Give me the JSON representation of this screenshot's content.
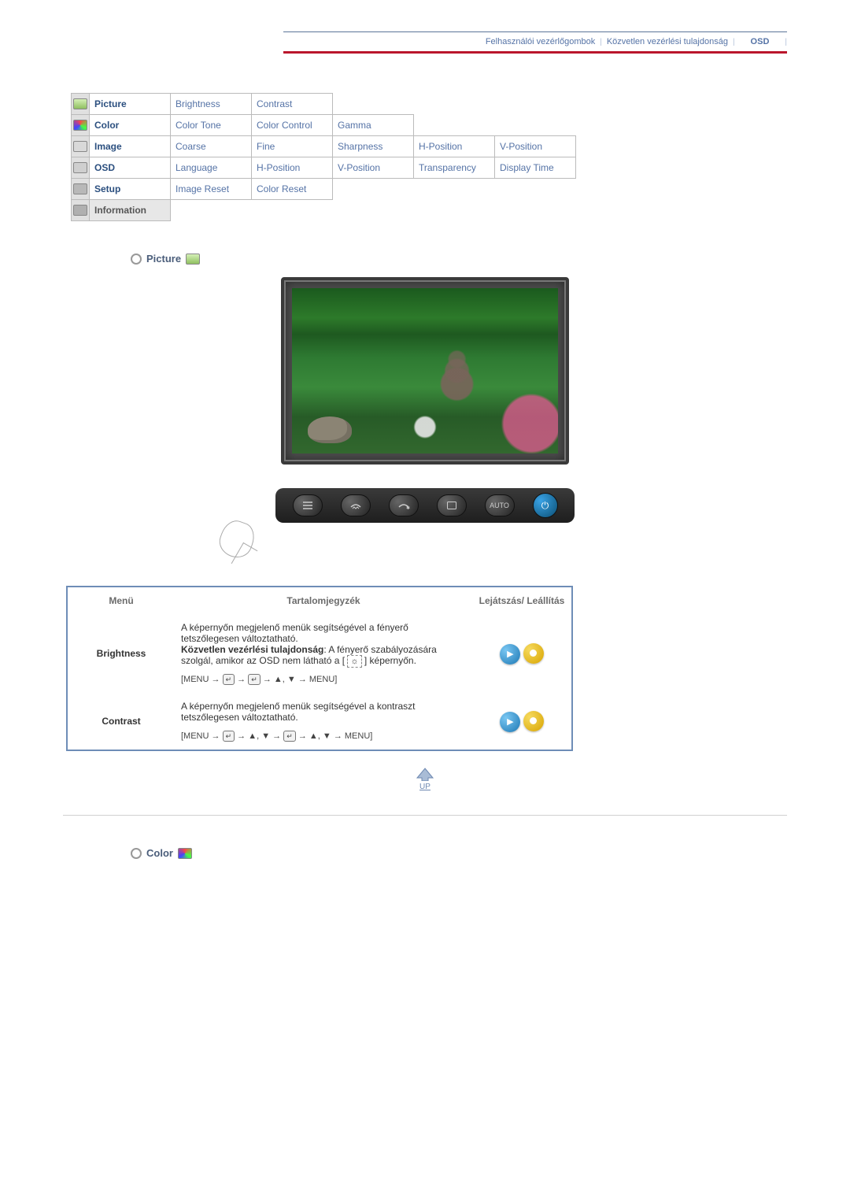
{
  "topnav": {
    "link1": "Felhasználói vezérlőgombok",
    "link2": "Közvetlen vezérlési tulajdonság",
    "current": "OSD"
  },
  "grid": {
    "picture": {
      "head": "Picture",
      "c1": "Brightness",
      "c2": "Contrast"
    },
    "color": {
      "head": "Color",
      "c1": "Color Tone",
      "c2": "Color Control",
      "c3": "Gamma"
    },
    "image": {
      "head": "Image",
      "c1": "Coarse",
      "c2": "Fine",
      "c3": "Sharpness",
      "c4": "H-Position",
      "c5": "V-Position"
    },
    "osd": {
      "head": "OSD",
      "c1": "Language",
      "c2": "H-Position",
      "c3": "V-Position",
      "c4": "Transparency",
      "c5": "Display Time"
    },
    "setup": {
      "head": "Setup",
      "c1": "Image Reset",
      "c2": "Color Reset"
    },
    "info": {
      "head": "Information"
    }
  },
  "section_picture": "Picture",
  "section_color": "Color",
  "buttons": {
    "auto": "AUTO"
  },
  "table": {
    "h_menu": "Menü",
    "h_desc": "Tartalomjegyzék",
    "h_play": "Lejátszás/ Leállítás",
    "rows": [
      {
        "menu": "Brightness",
        "desc_line1": "A képernyőn megjelenő menük segítségével a fényerő tetszőlegesen változtatható.",
        "desc_bold": "Közvetlen vezérlési tulajdonság",
        "desc_after_bold": ": A fényerő szabályozására szolgál, amikor az OSD nem látható a [",
        "desc_tail": "] képernyőn.",
        "nav_prefix": "[MENU →",
        "nav_mid": "→",
        "nav_tail": "→ ▲, ▼ → MENU]"
      },
      {
        "menu": "Contrast",
        "desc_line1": "A képernyőn megjelenő menük segítségével a kontraszt tetszőlegesen változtatható.",
        "nav_prefix": "[MENU →",
        "nav_mid1": "→ ▲, ▼ →",
        "nav_tail": "→ ▲, ▼ → MENU]"
      }
    ]
  },
  "up_label": "UP"
}
